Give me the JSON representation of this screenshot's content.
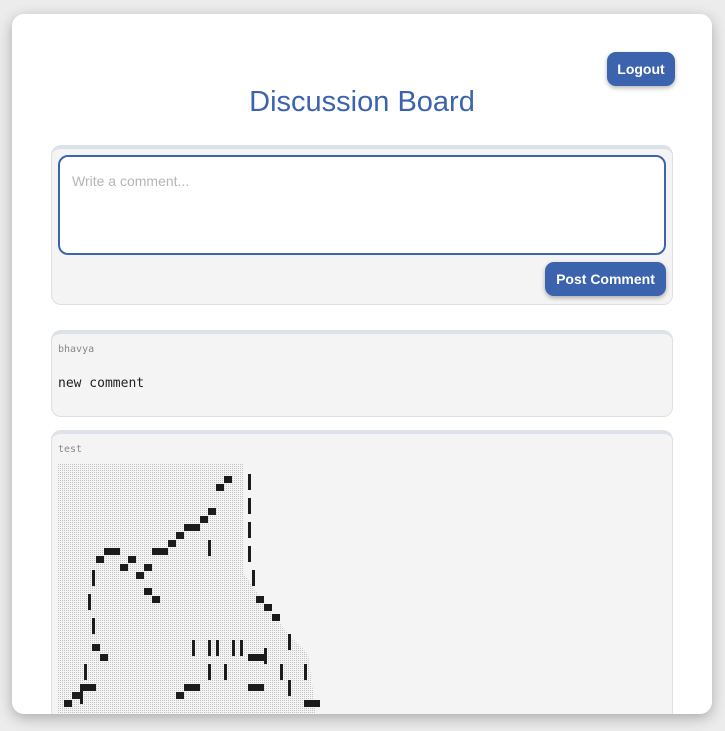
{
  "header": {
    "logout_label": "Logout",
    "title": "Discussion Board"
  },
  "composer": {
    "placeholder": "Write a comment...",
    "post_label": "Post Comment"
  },
  "comments": [
    {
      "author": "bhavya",
      "body": "new comment"
    },
    {
      "author": "test",
      "body_type": "ascii-art image"
    }
  ],
  "colors": {
    "accent": "#3c63ad",
    "card": "#ffffff",
    "panel": "#f4f4f4",
    "panel_top": "#dde1ea"
  }
}
